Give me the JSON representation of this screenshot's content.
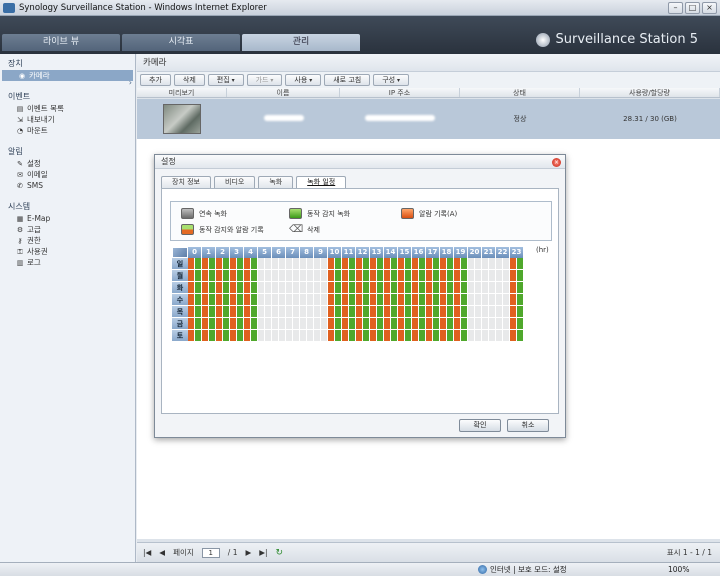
{
  "window": {
    "title": "Synology Surveillance Station - Windows Internet Explorer"
  },
  "app": {
    "brand": "Surveillance Station 5",
    "tabs": [
      {
        "label": "라이브 뷰",
        "active": false
      },
      {
        "label": "시각표",
        "active": false
      },
      {
        "label": "관리",
        "active": true
      }
    ]
  },
  "sidebar": {
    "groups": [
      {
        "title": "장치",
        "items": [
          {
            "label": "카메라",
            "icon": "camera-icon",
            "selected": true
          }
        ]
      },
      {
        "title": "이벤트",
        "items": [
          {
            "label": "이벤트 목록",
            "icon": "list-icon"
          },
          {
            "label": "내보내기",
            "icon": "export-icon"
          },
          {
            "label": "마운트",
            "icon": "mount-icon"
          }
        ]
      },
      {
        "title": "알림",
        "items": [
          {
            "label": "설정",
            "icon": "wrench-icon"
          },
          {
            "label": "이메일",
            "icon": "mail-icon"
          },
          {
            "label": "SMS",
            "icon": "sms-icon"
          }
        ]
      },
      {
        "title": "시스템",
        "items": [
          {
            "label": "E-Map",
            "icon": "map-icon"
          },
          {
            "label": "고급",
            "icon": "advanced-icon"
          },
          {
            "label": "권한",
            "icon": "permission-icon"
          },
          {
            "label": "사용권",
            "icon": "key-icon"
          },
          {
            "label": "로그",
            "icon": "log-icon"
          }
        ]
      }
    ]
  },
  "main": {
    "title": "카메라",
    "toolbar": [
      {
        "label": "추가",
        "dropdown": false,
        "disabled": false
      },
      {
        "label": "삭제",
        "dropdown": false,
        "disabled": false
      },
      {
        "label": "편집",
        "dropdown": true,
        "disabled": false
      },
      {
        "label": "가드",
        "dropdown": true,
        "disabled": true
      },
      {
        "label": "사용",
        "dropdown": true,
        "disabled": false
      },
      {
        "label": "새로 고침",
        "dropdown": false,
        "disabled": false
      },
      {
        "label": "구성",
        "dropdown": true,
        "disabled": false
      }
    ],
    "columns": [
      "미리보기",
      "이름",
      "IP 주소",
      "상태",
      "사용량/할당량"
    ],
    "rows": [
      {
        "status": "정상",
        "usage": "28.31 / 30 (GB)"
      }
    ],
    "pager": {
      "page_label": "페이지",
      "page_value": "1",
      "page_total": "/ 1",
      "display": "표시 1 - 1 / 1"
    }
  },
  "status_bar": {
    "zone": "인터넷 | 보호 모드: 설정",
    "zoom": "100%"
  },
  "dialog": {
    "title": "설정",
    "tabs": [
      {
        "label": "장치 정보",
        "active": false
      },
      {
        "label": "비디오",
        "active": false
      },
      {
        "label": "녹화",
        "active": false
      },
      {
        "label": "녹화 일정",
        "active": true
      }
    ],
    "legend": [
      {
        "label": "연속 녹화",
        "swatch": "gray"
      },
      {
        "label": "동작 감지 녹화",
        "swatch": "green"
      },
      {
        "label": "알람 기록(A)",
        "swatch": "orange"
      },
      {
        "label": "동작 감지와 알람 기록",
        "swatch": "mix"
      },
      {
        "label": "삭제",
        "swatch": "eraser"
      }
    ],
    "schedule": {
      "hour_unit": "(hr)",
      "hours": [
        "0",
        "1",
        "2",
        "3",
        "4",
        "5",
        "6",
        "7",
        "8",
        "9",
        "10",
        "11",
        "12",
        "13",
        "14",
        "15",
        "16",
        "17",
        "18",
        "19",
        "20",
        "21",
        "22",
        "23"
      ],
      "days": [
        "일",
        "월",
        "화",
        "수",
        "목",
        "금",
        "토"
      ],
      "active_hours": [
        0,
        1,
        2,
        3,
        4,
        10,
        11,
        12,
        13,
        14,
        15,
        16,
        17,
        18,
        19,
        23
      ]
    },
    "ok_label": "확인",
    "cancel_label": "취소"
  }
}
